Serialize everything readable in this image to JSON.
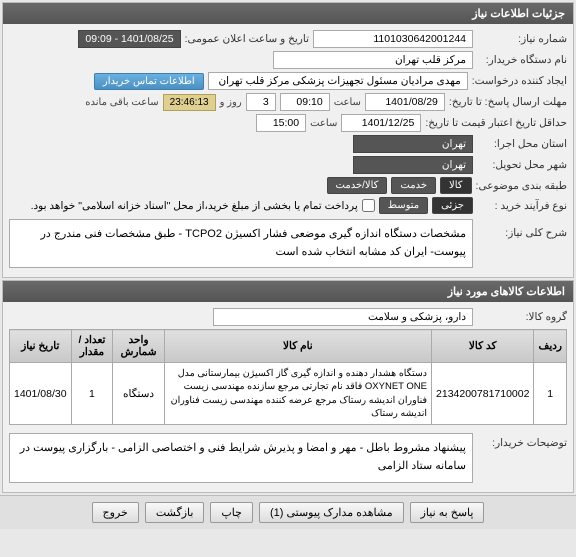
{
  "header": {
    "title": "جزئیات اطلاعات نیاز"
  },
  "fields": {
    "need_no_label": "شماره نیاز:",
    "need_no": "1101030642001244",
    "announce_label": "تاریخ و ساعت اعلان عمومی:",
    "announce": "1401/08/25 - 09:09",
    "buyer_label": "نام دستگاه خریدار:",
    "buyer": "مرکز قلب تهران",
    "creator_label": "ایجاد کننده درخواست:",
    "creator": "مهدی مرادیان مسئول تجهیزات پزشکی مرکز قلب تهران",
    "contact_btn": "اطلاعات تماس خریدار",
    "deadline_label": "مهلت ارسال پاسخ: تا تاریخ:",
    "deadline_date": "1401/08/29",
    "time_label": "ساعت",
    "deadline_time": "09:10",
    "days_label": "روز و",
    "days": "3",
    "timer": "23:46:13",
    "remain": "ساعت باقی مانده",
    "validity_label": "حداقل تاریخ اعتبار قیمت تا تاریخ:",
    "validity_date": "1401/12/25",
    "validity_time": "15:00",
    "exec_label": "استان محل اجرا:",
    "exec": "تهران",
    "deliver_label": "شهر محل تحویل:",
    "deliver": "تهران",
    "topic_label": "طبقه بندی موضوعی:",
    "topic_goods": "کالا",
    "topic_service": "خدمت",
    "topic_both": "کالا/خدمت",
    "process_label": "نوع فرآیند خرید :",
    "process_low": "جزئی",
    "process_mid": "متوسط",
    "pay_check": "پرداخت تمام یا بخشی از مبلغ خرید،از محل \"اسناد خزانه اسلامی\" خواهد بود.",
    "summary_label": "شرح کلی نیاز:",
    "summary": "مشخصات دستگاه اندازه گیری موضعی فشار اکسیژن TCPO2  -  طبق مشخصات فنی مندرج در پیوست- ایران کد مشابه انتخاب شده است"
  },
  "section2": {
    "title": "اطلاعات کالاهای مورد نیاز",
    "group_label": "گروه کالا:",
    "group": "دارو، پزشکی و سلامت",
    "cols": {
      "row": "ردیف",
      "code": "کد کالا",
      "name": "نام کالا",
      "unit": "واحد شمارش",
      "qty": "تعداد / مقدار",
      "date": "تاریخ نیاز"
    },
    "items": [
      {
        "row": "1",
        "code": "2134200781710002",
        "name": "دستگاه هشدار دهنده و اندازه گیری گاز اکسیژن بیمارستانی مدل OXYNET ONE فاقد نام تجارتی مرجع سازنده مهندسی زیست فناوران اندیشه رستاک مرجع عرضه کننده مهندسی زیست فناوران اندیشه رستاک",
        "unit": "دستگاه",
        "qty": "1",
        "date": "1401/08/30"
      }
    ],
    "notes_label": "توضیحات خریدار:",
    "notes": "پیشنهاد مشروط باطل - مهر و امضا و پذیرش شرایط فنی و اختصاصی الزامی - بارگزاری پیوست در سامانه ستاد الزامی"
  },
  "footer": {
    "respond": "پاسخ به نیاز",
    "attachments": "مشاهده مدارک پیوستی (1)",
    "print": "چاپ",
    "back": "بازگشت",
    "exit": "خروج"
  }
}
